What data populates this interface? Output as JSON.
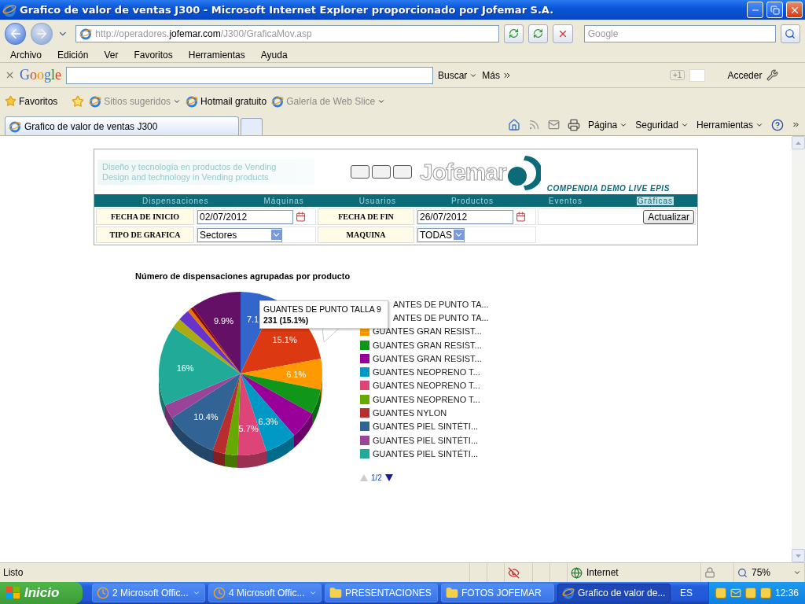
{
  "window": {
    "title": "Grafico de valor de ventas J300 - Microsoft Internet Explorer proporcionado por Jofemar S.A."
  },
  "address": {
    "url_parts": [
      "http://operadores.",
      "jofemar.com",
      "/J300/GraficaMov.asp"
    ]
  },
  "search": {
    "placeholder": "Google"
  },
  "menu": [
    "Archivo",
    "Edición",
    "Ver",
    "Favoritos",
    "Herramientas",
    "Ayuda"
  ],
  "google_toolbar": {
    "logo": "Google",
    "search_button": "Buscar",
    "more": "Más",
    "plus_one": "+1",
    "sign_in": "Acceder"
  },
  "favorites": {
    "label": "Favoritos",
    "links": [
      {
        "label": "Sitios sugeridos",
        "dimmed": true,
        "dropdown": true
      },
      {
        "label": "Hotmail gratuito",
        "dimmed": false,
        "dropdown": false
      },
      {
        "label": "Galería de Web Slice",
        "dimmed": true,
        "dropdown": true
      }
    ]
  },
  "tabs": [
    {
      "label": "Grafico de valor de ventas J300",
      "selected": true
    }
  ],
  "command_bar": [
    "Página",
    "Seguridad",
    "Herramientas"
  ],
  "page": {
    "header": {
      "tagline": [
        "Diseño y tecnología en productos de Vending",
        "Design and technology in Vending products"
      ],
      "brand": "Jofemar",
      "subtitle": "COMPENDIA DEMO LIVE EPIS"
    },
    "nav": [
      {
        "label": "Dispensaciones",
        "selected": false
      },
      {
        "label": "Máquinas",
        "selected": false
      },
      {
        "label": "Usuarios",
        "selected": false
      },
      {
        "label": "Productos",
        "selected": false
      },
      {
        "label": "Eventos",
        "selected": false
      },
      {
        "label": "Gráficas",
        "selected": true
      }
    ],
    "filters": {
      "start_date": {
        "label": "FECHA DE INICIO",
        "value": "02/07/2012"
      },
      "end_date": {
        "label": "FECHA DE FIN",
        "value": "26/07/2012"
      },
      "update_button": "Actualizar",
      "chart_type": {
        "label": "TIPO DE GRAFICA",
        "value": "Sectores"
      },
      "machine": {
        "label": "MAQUINA",
        "value": "TODAS"
      }
    },
    "chart": {
      "chart_data": {
        "type": "pie",
        "title": "Número de dispensaciones agrupadas por producto",
        "values": [
          7.1,
          15.1,
          6.1,
          5,
          5.5,
          6.3,
          5.7,
          2.5,
          2.5,
          10.4,
          2.8,
          16,
          2,
          2.3,
          0.7,
          0.6,
          9.9
        ],
        "colors": [
          "#3366cc",
          "#dc3912",
          "#ff9900",
          "#109618",
          "#990099",
          "#0099c6",
          "#dd4477",
          "#66aa00",
          "#b82e2e",
          "#316395",
          "#994499",
          "#22aa99",
          "#aaaa11",
          "#6633cc",
          "#e67300",
          "#8b0707",
          "#651067"
        ],
        "value_labels": [
          "7.1",
          "15.1%",
          "6.1%",
          null,
          null,
          "6.3%",
          "5.7%",
          null,
          null,
          "10.4%",
          null,
          "16%",
          null,
          null,
          null,
          null,
          "9.9%"
        ]
      },
      "legend": [
        {
          "label": "ANTES DE PUNTO TA...",
          "covered": true
        },
        {
          "label": "ANTES DE PUNTO TA...",
          "covered": true
        },
        {
          "label": "GUANTES GRAN RESIST...",
          "covered": false,
          "color": "#ff9900"
        },
        {
          "label": "GUANTES GRAN RESIST...",
          "covered": false,
          "color": "#109618"
        },
        {
          "label": "GUANTES GRAN RESIST...",
          "covered": false,
          "color": "#990099"
        },
        {
          "label": "GUANTES NEOPRENO T...",
          "covered": false,
          "color": "#0099c6"
        },
        {
          "label": "GUANTES NEOPRENO T...",
          "covered": false,
          "color": "#dd4477"
        },
        {
          "label": "GUANTES NEOPRENO T...",
          "covered": false,
          "color": "#66aa00"
        },
        {
          "label": "GUANTES NYLON",
          "covered": false,
          "color": "#b82e2e"
        },
        {
          "label": "GUANTES PIEL SINTÉTI...",
          "covered": false,
          "color": "#316395"
        },
        {
          "label": "GUANTES PIEL SINTÉTI...",
          "covered": false,
          "color": "#994499"
        },
        {
          "label": "GUANTES PIEL SINTÉTI...",
          "covered": false,
          "color": "#22aa99"
        }
      ],
      "tooltip": {
        "title": "GUANTES DE PUNTO TALLA 9",
        "value": "231 (15.1%)"
      },
      "pager": "1/2"
    }
  },
  "status_bar": {
    "text": "Listo",
    "zone": "Internet",
    "zoom": "75%"
  },
  "taskbar": {
    "start": "Inicio",
    "items": [
      {
        "label": "2 Microsoft Offic...",
        "kind": "group",
        "selected": false
      },
      {
        "label": "4 Microsoft Offic...",
        "kind": "group",
        "selected": false
      },
      {
        "label": "PRESENTACIONES",
        "kind": "folder",
        "selected": false
      },
      {
        "label": "FOTOS JOFEMAR",
        "kind": "folder",
        "selected": false
      },
      {
        "label": "Grafico de valor de...",
        "kind": "browser",
        "selected": true
      }
    ],
    "language": "ES",
    "clock": "12:36"
  }
}
